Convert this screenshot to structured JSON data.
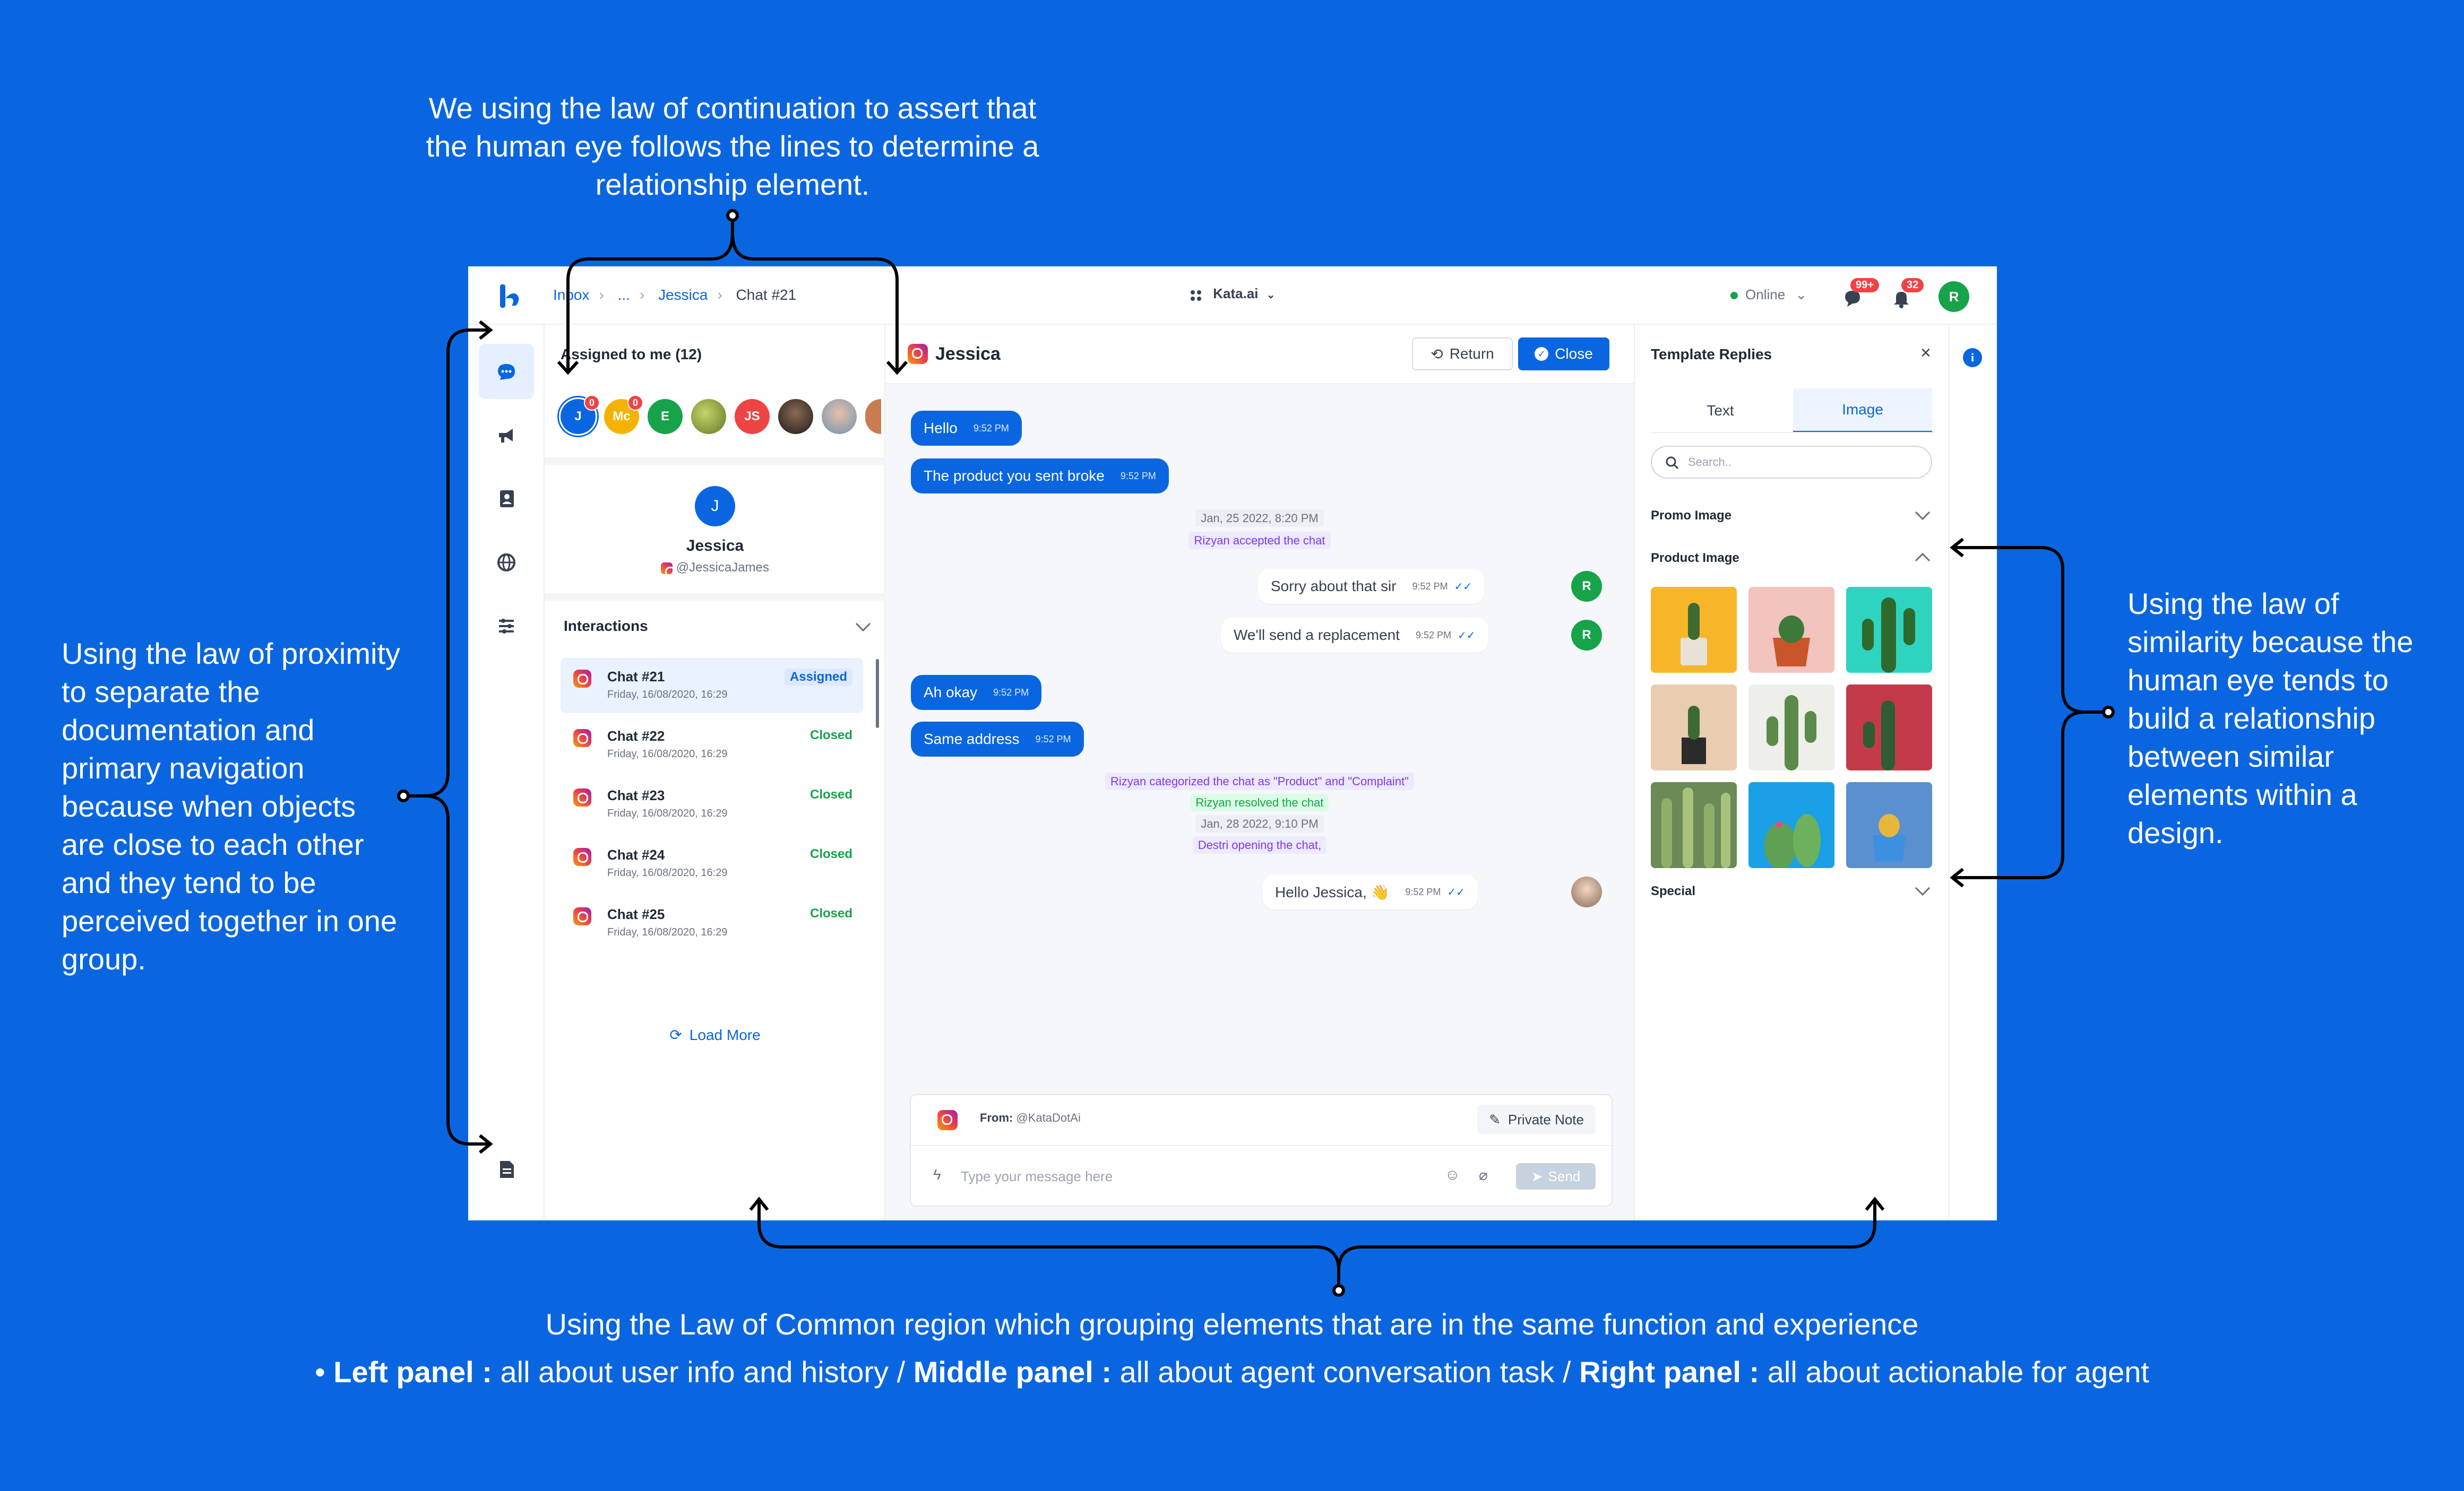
{
  "annotations": {
    "top": "We using the law of continuation to assert that the human eye follows the lines to determine a relationship element.",
    "left": "Using the law of proximity to separate the documentation and primary navigation because when objects are close to each other and they tend to be perceived together in one group.",
    "right": "Using the law of similarity because the human eye tends to build a relationship between similar elements within a design.",
    "bottom": "Using the Law of Common region which grouping elements that are in the same function and experience",
    "bullet": {
      "left_label": "Left panel :",
      "left_text": "all about user info and history /",
      "middle_label": "Middle panel :",
      "middle_text": "all about agent conversation task /",
      "right_label": "Right panel :",
      "right_text": "all about actionable for agent"
    }
  },
  "colors": {
    "background": "#0A66E0",
    "accent": "#0A66E0",
    "success": "#16a34a",
    "danger": "#ef4444",
    "system_purple": "#7c3aed"
  },
  "topbar": {
    "breadcrumb": [
      "Inbox",
      "...",
      "Jessica",
      "Chat #21"
    ],
    "workspace": "Kata.ai",
    "status": "Online",
    "chat_badge": "99+",
    "notif_badge": "32",
    "user_initial": "R"
  },
  "nav": {
    "icons": [
      "chat-icon",
      "megaphone-icon",
      "contact-icon",
      "globe-icon",
      "sliders-icon",
      "document-icon"
    ]
  },
  "left_panel": {
    "assigned_header": "Assigned to me (12)",
    "avatars": [
      {
        "label": "J",
        "color": "#0A66E0",
        "count": "0"
      },
      {
        "label": "Mc",
        "color": "#f5b301",
        "count": "0"
      },
      {
        "label": "E",
        "color": "#16a34a",
        "count": ""
      },
      {
        "label": "",
        "color": "#8a9a3a",
        "count": ""
      },
      {
        "label": "JS",
        "color": "#ef4444",
        "count": ""
      },
      {
        "label": "",
        "color": "#3b2f2a",
        "count": ""
      },
      {
        "label": "",
        "color": "#7aa0b8",
        "count": ""
      }
    ],
    "profile": {
      "initial": "J",
      "name": "Jessica",
      "handle": "@JessicaJames"
    },
    "interactions_label": "Interactions",
    "chats": [
      {
        "title": "Chat #21",
        "date": "Friday, 16/08/2020, 16:29",
        "status": "Assigned"
      },
      {
        "title": "Chat #22",
        "date": "Friday, 16/08/2020, 16:29",
        "status": "Closed"
      },
      {
        "title": "Chat #23",
        "date": "Friday, 16/08/2020, 16:29",
        "status": "Closed"
      },
      {
        "title": "Chat #24",
        "date": "Friday, 16/08/2020, 16:29",
        "status": "Closed"
      },
      {
        "title": "Chat #25",
        "date": "Friday, 16/08/2020, 16:29",
        "status": "Closed"
      }
    ],
    "load_more": "Load More"
  },
  "conversation": {
    "contact_name": "Jessica",
    "return_label": "Return",
    "close_label": "Close",
    "messages": {
      "m1": {
        "text": "Hello",
        "time": "9:52 PM"
      },
      "m2": {
        "text": "The product you sent broke",
        "time": "9:52 PM"
      },
      "sys1_date": "Jan, 25 2022, 8:20 PM",
      "sys1_event": "Rizyan accepted the chat",
      "m3": {
        "text": "Sorry about that sir",
        "time": "9:52 PM"
      },
      "m4": {
        "text": "We'll send a replacement",
        "time": "9:52 PM"
      },
      "m5": {
        "text": "Ah okay",
        "time": "9:52 PM"
      },
      "m6": {
        "text": "Same address",
        "time": "9:52 PM"
      },
      "sys2_event": "Rizyan categorized the chat as \"Product\" and \"Complaint\"",
      "sys3_event": "Rizyan resolved the chat",
      "sys4_date": "Jan, 28 2022, 9:10 PM",
      "sys4_event": "Destri opening the chat,",
      "m7": {
        "text": "Hello Jessica, 👋",
        "time": "9:52 PM"
      }
    },
    "agent_initial": "R",
    "compose": {
      "from_label": "From:",
      "from_value": "@KataDotAi",
      "private_note": "Private Note",
      "placeholder": "Type your message here",
      "send": "Send"
    }
  },
  "right_panel": {
    "title": "Template Replies",
    "tabs": {
      "text": "Text",
      "image": "Image"
    },
    "search_placeholder": "Search..",
    "sections": {
      "promo": "Promo Image",
      "product": "Product Image",
      "special": "Special"
    },
    "product_images": [
      "cactus-yellow-bg",
      "cactus-pink-bg",
      "cactus-teal-bg",
      "cactus-beige-bg",
      "cactus-white-bg",
      "cactus-red-bg",
      "cactus-field",
      "cactus-sky",
      "cactus-blue-pot"
    ]
  }
}
